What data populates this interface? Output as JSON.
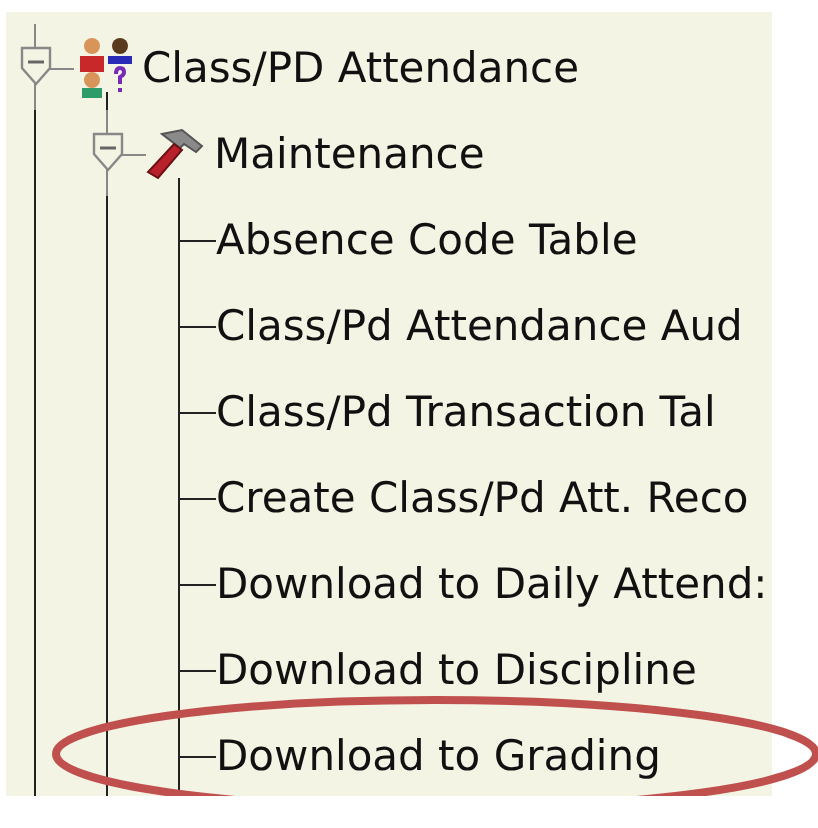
{
  "tree": [
    {
      "label": "Class/PD Attendance",
      "kind": "people",
      "expanded": true,
      "circled": false,
      "children": [
        {
          "label": "Maintenance",
          "kind": "hammer",
          "expanded": true,
          "circled": false,
          "children": [
            {
              "label": "Absence Code Table",
              "circled": false
            },
            {
              "label": "Class/Pd Attendance Aud",
              "circled": false
            },
            {
              "label": "Class/Pd Transaction Tal",
              "circled": false
            },
            {
              "label": "Create Class/Pd Att. Reco",
              "circled": false
            },
            {
              "label": "Download to Daily Attend:",
              "circled": false
            },
            {
              "label": "Download to Discipline",
              "circled": false
            },
            {
              "label": "Download to Grading",
              "circled": true
            }
          ]
        }
      ]
    }
  ]
}
